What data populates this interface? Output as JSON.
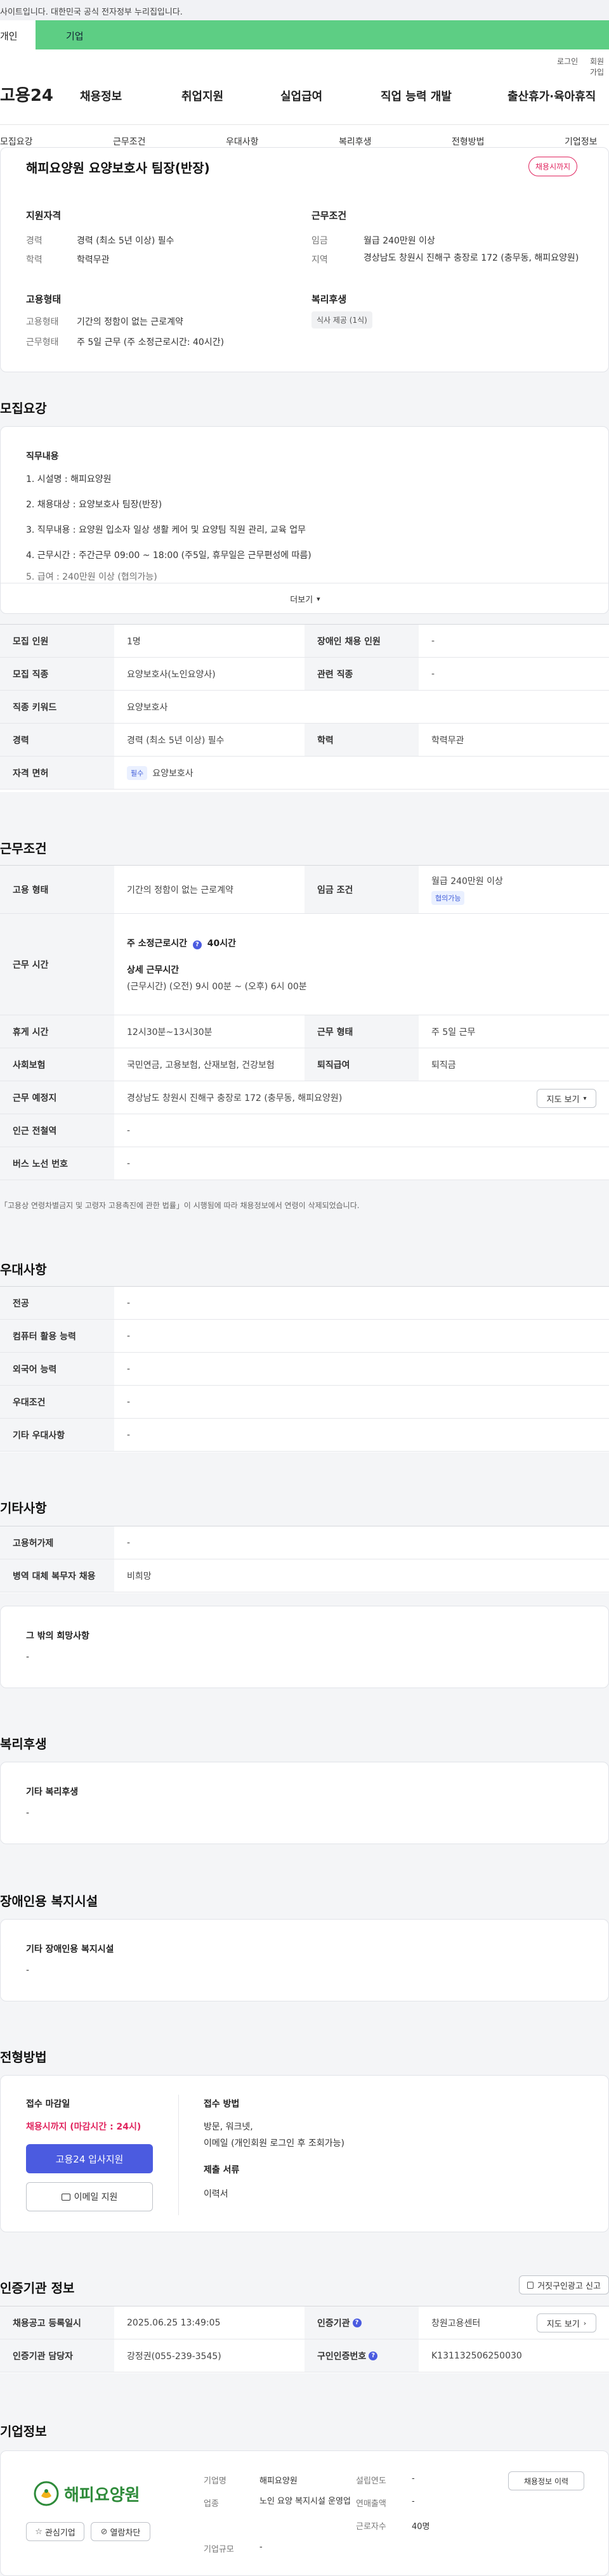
{
  "topbar": {
    "notice": "사이트입니다. 대한민국 공식 전자정부 누리집입니다."
  },
  "tabs": {
    "personal": "개인",
    "company": "기업"
  },
  "header": {
    "login": "로그인",
    "join": "회원가입",
    "logo": "고용24",
    "nav": [
      "채용정보",
      "취업지원",
      "실업급여",
      "직업 능력 개발",
      "출산휴가·육아휴직"
    ]
  },
  "subnav": [
    "모집요강",
    "근무조건",
    "우대사항",
    "복리후생",
    "전형방법",
    "기업정보"
  ],
  "summary": {
    "title": "해피요양원 요양보호사 팀장(반장)",
    "status": "채용시까지",
    "qual": {
      "heading": "지원자격",
      "career_label": "경력",
      "career": "경력 (최소 5년 이상) 필수",
      "edu_label": "학력",
      "edu": "학력무관"
    },
    "cond": {
      "heading": "근무조건",
      "wage_label": "임금",
      "wage": "월급 240만원 이상",
      "region_label": "지역",
      "region": "경상남도 창원시 진해구 충장로 172 (충무동, 해피요양원)"
    },
    "employ": {
      "heading": "고용형태",
      "type_label": "고용형태",
      "type": "기간의 정함이 없는 근로계약",
      "form_label": "근무형태",
      "form": "주 5일 근무 (주 소정근로시간: 40시간)"
    },
    "welfare": {
      "heading": "복리후생",
      "tag": "식사 제공 (1식)"
    }
  },
  "recruit": {
    "heading": "모집요강",
    "job_label": "직무내용",
    "lines": [
      "1. 시설명 : 해피요양원",
      "2. 채용대상 : 요양보호사 팀장(반장)",
      "3. 직무내용 : 요양원 입소자 일상 생활 케어 및 요양팀 직원 관리, 교육 업무",
      "4. 근무시간 : 주간근무 09:00 ~ 18:00 (주5일, 휴무일은 근무편성에 따름)",
      "5. 급여 : 240만원 이상 (협의가능)"
    ],
    "more": "더보기"
  },
  "recruit_table": {
    "count_label": "모집 인원",
    "count": "1명",
    "disabled_label": "장애인 채용 인원",
    "disabled": "-",
    "job_label": "모집 직종",
    "job": "요양보호사(노인요양사)",
    "related_label": "관련 직종",
    "related": "-",
    "keyword_label": "직종 키워드",
    "keyword": "요양보호사",
    "career_label": "경력",
    "career": "경력 (최소 5년 이상) 필수",
    "edu_label": "학력",
    "edu": "학력무관",
    "license_label": "자격 면허",
    "license_tag": "필수",
    "license": "요양보호사"
  },
  "work": {
    "heading": "근무조건",
    "type_label": "고용 형태",
    "type": "기간의 정함이 없는 근로계약",
    "wage_label": "임금 조건",
    "wage": "월급 240만원 이상",
    "wage_tag": "협의가능",
    "hours_label": "근무 시간",
    "hours_weekly_label": "주 소정근로시간",
    "hours_weekly": "40시간",
    "hours_detail_label": "상세 근무시간",
    "hours_detail": "(근무시간) (오전) 9시 00분 ~ (오후) 6시 00분",
    "break_label": "휴게 시간",
    "break": "12시30분~13시30분",
    "form_label": "근무 형태",
    "form": "주 5일 근무",
    "insurance_label": "사회보험",
    "insurance": "국민연금, 고용보험, 산재보험, 건강보험",
    "severance_label": "퇴직급여",
    "severance": "퇴직금",
    "place_label": "근무 예정지",
    "place": "경상남도 창원시 진해구 충장로 172 (충무동, 해피요양원)",
    "map_btn": "지도 보기",
    "subway_label": "인근 전철역",
    "subway": "-",
    "bus_label": "버스 노선 번호",
    "bus": "-",
    "note": "「고용상 연령차별금지 및 고령자 고용촉진에 관한 법률」이 시행됨에 따라 채용정보에서 연령이 삭제되었습니다."
  },
  "pref": {
    "heading": "우대사항",
    "rows": [
      {
        "label": "전공",
        "value": "-"
      },
      {
        "label": "컴퓨터 활용 능력",
        "value": "-"
      },
      {
        "label": "외국어 능력",
        "value": "-"
      },
      {
        "label": "우대조건",
        "value": "-"
      },
      {
        "label": "기타 우대사항",
        "value": "-"
      }
    ]
  },
  "other": {
    "heading": "기타사항",
    "rows": [
      {
        "label": "고용허가제",
        "value": "-"
      },
      {
        "label": "병역 대체 복무자 채용",
        "value": "비희망"
      }
    ],
    "wish_label": "그 밖의 희망사항",
    "wish": "-"
  },
  "welfare": {
    "heading": "복리후생",
    "label": "기타 복리후생",
    "value": "-"
  },
  "disability": {
    "heading": "장애인용 복지시설",
    "label": "기타 장애인용 복지시설",
    "value": "-"
  },
  "selection": {
    "heading": "전형방법",
    "deadline_label": "접수 마감일",
    "deadline": "채용시까지 (마감시간 : 24시)",
    "apply_btn": "고용24 입사지원",
    "email_btn": "이메일 지원",
    "method_label": "접수 방법",
    "method1": "방문, 워크넷,",
    "method2": "이메일 (개인회원 로그인 후 조회가능)",
    "docs_label": "제출 서류",
    "docs": "이력서"
  },
  "agency": {
    "heading": "인증기관 정보",
    "report_btn": "거짓구인광고 신고",
    "reg_label": "채용공고 등록일시",
    "reg": "2025.06.25 13:49:05",
    "agency_label": "인증기관",
    "agency": "창원고용센터",
    "map_btn": "지도 보기",
    "staff_label": "인증기관 담당자",
    "staff": "강정권(055-239-3545)",
    "id_label": "구인인증번호",
    "id": "K131132506250030"
  },
  "company": {
    "heading": "기업정보",
    "logo_text": "해피요양원",
    "fav_btn": "관심기업",
    "block_btn": "열람차단",
    "name_label": "기업명",
    "name": "해피요양원",
    "industry_label": "업종",
    "industry": "노인 요양 복지시설 운영업",
    "scale_label": "기업규모",
    "scale": "-",
    "founded_label": "설립연도",
    "founded": "-",
    "revenue_label": "연매출액",
    "revenue": "-",
    "employees_label": "근로자수",
    "employees": "40명",
    "history_btn": "채용정보 이력"
  },
  "colors": {
    "accent": "#4b5be0",
    "status_red": "#e0245e",
    "brand_green": "#5dce84",
    "logo_green": "#2e8b3a"
  }
}
